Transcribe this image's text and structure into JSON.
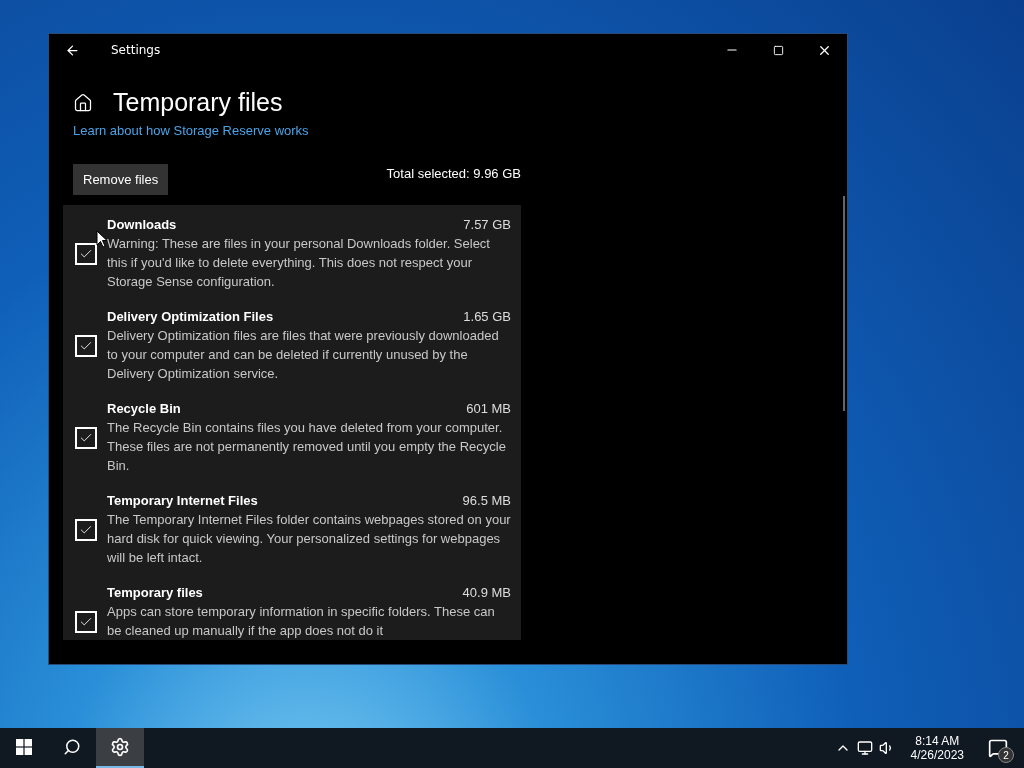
{
  "window": {
    "title": "Settings"
  },
  "page": {
    "title": "Temporary files",
    "link": "Learn about how Storage Reserve works",
    "remove_button": "Remove files",
    "total": "Total selected: 9.96 GB"
  },
  "items": [
    {
      "name": "Downloads",
      "size": "7.57 GB",
      "description": "Warning: These are files in your personal Downloads folder. Select this if you'd like to delete everything. This does not respect your Storage Sense configuration.",
      "checked": true
    },
    {
      "name": "Delivery Optimization Files",
      "size": "1.65 GB",
      "description": "Delivery Optimization files are files that were previously downloaded to your computer and can be deleted if currently unused by the Delivery Optimization service.",
      "checked": true
    },
    {
      "name": "Recycle Bin",
      "size": "601 MB",
      "description": "The Recycle Bin contains files you have deleted from your computer. These files are not permanently removed until you empty the Recycle Bin.",
      "checked": true
    },
    {
      "name": "Temporary Internet Files",
      "size": "96.5 MB",
      "description": "The Temporary Internet Files folder contains webpages stored on your hard disk for quick viewing. Your personalized settings for webpages will be left intact.",
      "checked": true
    },
    {
      "name": "Temporary files",
      "size": "40.9 MB",
      "description": "Apps can store temporary information in specific folders. These can be cleaned up manually if the app does not do it",
      "checked": true
    }
  ],
  "taskbar": {
    "apps": [
      {
        "kind": "start",
        "selected": false
      },
      {
        "kind": "search",
        "selected": false
      },
      {
        "kind": "settings",
        "selected": true
      }
    ],
    "time": "8:14 AM",
    "date": "4/26/2023",
    "notifications": "2"
  }
}
